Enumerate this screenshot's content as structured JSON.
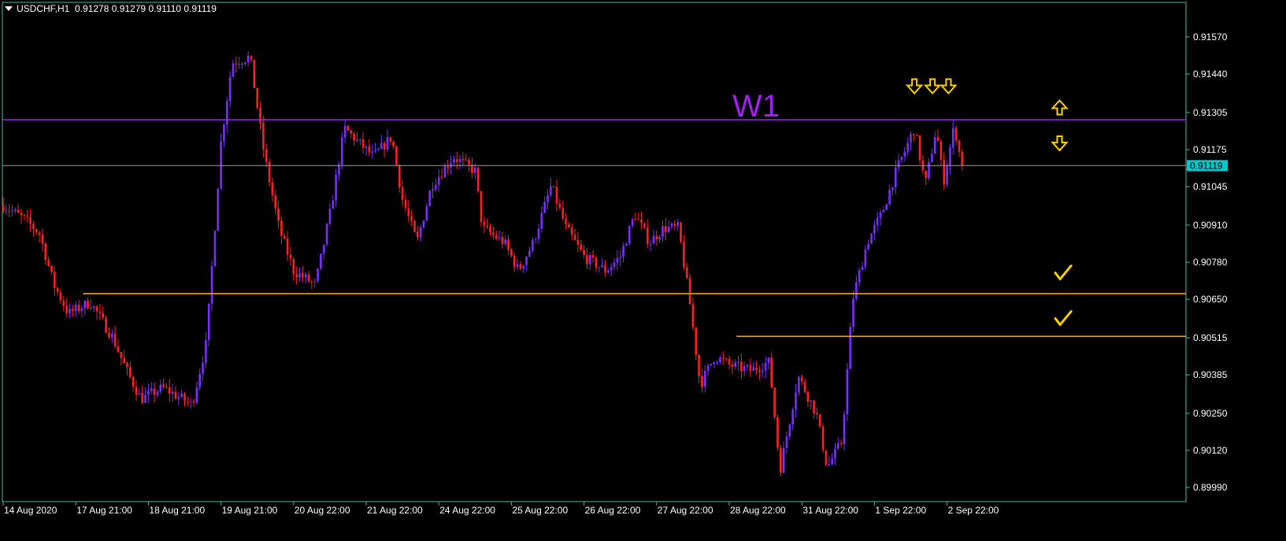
{
  "header": {
    "symbol_timeframe": "USDCHF,H1",
    "ohlc": "0.91278 0.91279 0.91110 0.91119"
  },
  "colors": {
    "background": "#000000",
    "frame": "#3fbf9f",
    "bull": "#7b2cff",
    "bear": "#ff1f1f",
    "resistance": "#a020f0",
    "support": "#ffb000",
    "current_price": "#9e9e9e",
    "price_badge": "#00c8c8",
    "arrows": "#ffd000"
  },
  "chart_data": {
    "type": "candlestick",
    "timeframe": "H1",
    "ylim": [
      0.8992,
      0.9172
    ],
    "y_ticks": [
      "0.91570",
      "0.91440",
      "0.91305",
      "0.91175",
      "0.91045",
      "0.90910",
      "0.90780",
      "0.90650",
      "0.90515",
      "0.90385",
      "0.90250",
      "0.90120",
      "0.89990"
    ],
    "x_ticks": [
      "14 Aug 2020",
      "17 Aug 21:00",
      "18 Aug 21:00",
      "19 Aug 21:00",
      "20 Aug 22:00",
      "21 Aug 22:00",
      "24 Aug 22:00",
      "25 Aug 22:00",
      "26 Aug 22:00",
      "27 Aug 22:00",
      "28 Aug 22:00",
      "31 Aug 22:00",
      "1 Sep 22:00",
      "2 Sep 22:00"
    ],
    "current_price": "0.91119",
    "levels": [
      {
        "name": "resistance",
        "price": 0.9128,
        "label": "W1"
      },
      {
        "name": "support-1",
        "price": 0.9067,
        "from_category": 1.1
      },
      {
        "name": "support-2",
        "price": 0.9052,
        "from_category": 10.1
      }
    ],
    "price_path": [
      {
        "x": 0.0,
        "p": 0.9098
      },
      {
        "x": 0.3,
        "p": 0.9093
      },
      {
        "x": 0.5,
        "p": 0.9088
      },
      {
        "x": 0.7,
        "p": 0.907
      },
      {
        "x": 0.9,
        "p": 0.906
      },
      {
        "x": 1.2,
        "p": 0.9064
      },
      {
        "x": 1.5,
        "p": 0.9052
      },
      {
        "x": 1.7,
        "p": 0.904
      },
      {
        "x": 1.9,
        "p": 0.903
      },
      {
        "x": 2.2,
        "p": 0.9034
      },
      {
        "x": 2.6,
        "p": 0.9028
      },
      {
        "x": 2.8,
        "p": 0.905
      },
      {
        "x": 3.0,
        "p": 0.912
      },
      {
        "x": 3.15,
        "p": 0.9148
      },
      {
        "x": 3.4,
        "p": 0.915
      },
      {
        "x": 3.6,
        "p": 0.9115
      },
      {
        "x": 3.8,
        "p": 0.909
      },
      {
        "x": 4.0,
        "p": 0.9075
      },
      {
        "x": 4.3,
        "p": 0.907
      },
      {
        "x": 4.5,
        "p": 0.9095
      },
      {
        "x": 4.7,
        "p": 0.9125
      },
      {
        "x": 4.9,
        "p": 0.912
      },
      {
        "x": 5.1,
        "p": 0.9115
      },
      {
        "x": 5.35,
        "p": 0.9122
      },
      {
        "x": 5.5,
        "p": 0.91
      },
      {
        "x": 5.7,
        "p": 0.9085
      },
      {
        "x": 5.9,
        "p": 0.9105
      },
      {
        "x": 6.2,
        "p": 0.9115
      },
      {
        "x": 6.5,
        "p": 0.911
      },
      {
        "x": 6.6,
        "p": 0.909
      },
      {
        "x": 6.9,
        "p": 0.9085
      },
      {
        "x": 7.1,
        "p": 0.9075
      },
      {
        "x": 7.3,
        "p": 0.9085
      },
      {
        "x": 7.55,
        "p": 0.9105
      },
      {
        "x": 7.75,
        "p": 0.909
      },
      {
        "x": 8.0,
        "p": 0.908
      },
      {
        "x": 8.3,
        "p": 0.9075
      },
      {
        "x": 8.5,
        "p": 0.908
      },
      {
        "x": 8.7,
        "p": 0.9095
      },
      {
        "x": 8.9,
        "p": 0.9085
      },
      {
        "x": 9.1,
        "p": 0.909
      },
      {
        "x": 9.3,
        "p": 0.909
      },
      {
        "x": 9.45,
        "p": 0.9065
      },
      {
        "x": 9.6,
        "p": 0.9035
      },
      {
        "x": 9.8,
        "p": 0.9045
      },
      {
        "x": 10.0,
        "p": 0.9042
      },
      {
        "x": 10.3,
        "p": 0.904
      },
      {
        "x": 10.55,
        "p": 0.9043
      },
      {
        "x": 10.7,
        "p": 0.9005
      },
      {
        "x": 10.95,
        "p": 0.9038
      },
      {
        "x": 11.2,
        "p": 0.9025
      },
      {
        "x": 11.35,
        "p": 0.9006
      },
      {
        "x": 11.55,
        "p": 0.9015
      },
      {
        "x": 11.7,
        "p": 0.9065
      },
      {
        "x": 11.9,
        "p": 0.9085
      },
      {
        "x": 12.1,
        "p": 0.9095
      },
      {
        "x": 12.3,
        "p": 0.911
      },
      {
        "x": 12.55,
        "p": 0.9125
      },
      {
        "x": 12.7,
        "p": 0.9105
      },
      {
        "x": 12.85,
        "p": 0.9125
      },
      {
        "x": 12.95,
        "p": 0.9106
      },
      {
        "x": 13.1,
        "p": 0.9126
      },
      {
        "x": 13.2,
        "p": 0.91119
      }
    ],
    "markers": [
      {
        "type": "arrow-down",
        "x": 12.55,
        "p": 0.914
      },
      {
        "type": "arrow-down",
        "x": 12.8,
        "p": 0.914
      },
      {
        "type": "arrow-down",
        "x": 13.02,
        "p": 0.914
      },
      {
        "type": "arrow-up",
        "x": 14.55,
        "p": 0.9132
      },
      {
        "type": "arrow-down",
        "x": 14.55,
        "p": 0.912
      },
      {
        "type": "check",
        "x": 14.6,
        "p": 0.9074
      },
      {
        "type": "check",
        "x": 14.6,
        "p": 0.9058
      }
    ]
  }
}
